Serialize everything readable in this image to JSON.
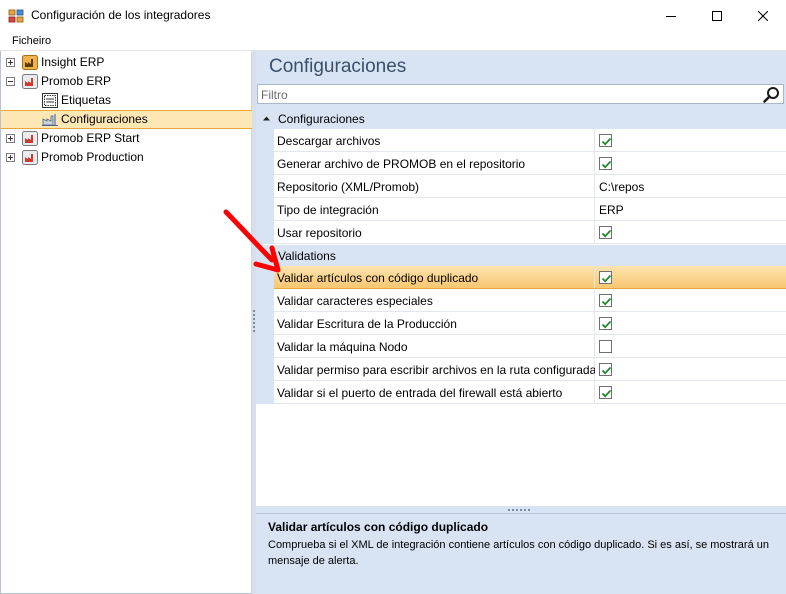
{
  "window": {
    "title": "Configuración de los integradores"
  },
  "menu": {
    "items": [
      "Ficheiro"
    ]
  },
  "tree": {
    "items": [
      {
        "label": "Insight ERP",
        "icon": "factory-icon",
        "expander": "plus"
      },
      {
        "label": "Promob ERP",
        "icon": "factory-icon",
        "expander": "minus"
      },
      {
        "label": "Etiquetas",
        "icon": "label-sheet-icon",
        "expander": null
      },
      {
        "label": "Configuraciones",
        "icon": "factory-config-icon",
        "expander": null,
        "selected": true
      },
      {
        "label": "Promob ERP Start",
        "icon": "factory-icon",
        "expander": "plus"
      },
      {
        "label": "Promob Production",
        "icon": "factory-icon",
        "expander": "plus"
      }
    ]
  },
  "main": {
    "title": "Configuraciones",
    "filter_placeholder": "Filtro"
  },
  "grid": {
    "categories": [
      {
        "label": "Configuraciones",
        "rows": [
          {
            "name": "Descargar archivos",
            "type": "check",
            "checked": true
          },
          {
            "name": "Generar archivo de PROMOB en el repositorio",
            "type": "check",
            "checked": true
          },
          {
            "name": "Repositorio (XML/Promob)",
            "type": "text",
            "value": "C:\\repos"
          },
          {
            "name": "Tipo de integración",
            "type": "text",
            "value": "ERP"
          },
          {
            "name": "Usar repositorio",
            "type": "check",
            "checked": true
          }
        ]
      },
      {
        "label": "Validations",
        "rows": [
          {
            "name": "Validar artículos con código duplicado",
            "type": "check",
            "checked": true,
            "selected": true
          },
          {
            "name": "Validar caracteres especiales",
            "type": "check",
            "checked": true
          },
          {
            "name": "Validar Escritura de la Producción",
            "type": "check",
            "checked": true
          },
          {
            "name": "Validar la máquina Nodo",
            "type": "check",
            "checked": false
          },
          {
            "name": "Validar permiso para escribir archivos en la ruta configurada",
            "type": "check",
            "checked": true
          },
          {
            "name": "Validar si el puerto de entrada del firewall está abierto",
            "type": "check",
            "checked": true
          }
        ]
      }
    ]
  },
  "description": {
    "title": "Validar artículos con código duplicado",
    "text": "Comprueba si el XML de integración contiene artículos con código duplicado. Si es así, se mostrará un mensaje de alerta."
  },
  "colors": {
    "selection": "#fde7b5",
    "selection_border": "#e9a639",
    "panel_bg": "#d8e4f3",
    "annotation_arrow": "#ff0000"
  }
}
